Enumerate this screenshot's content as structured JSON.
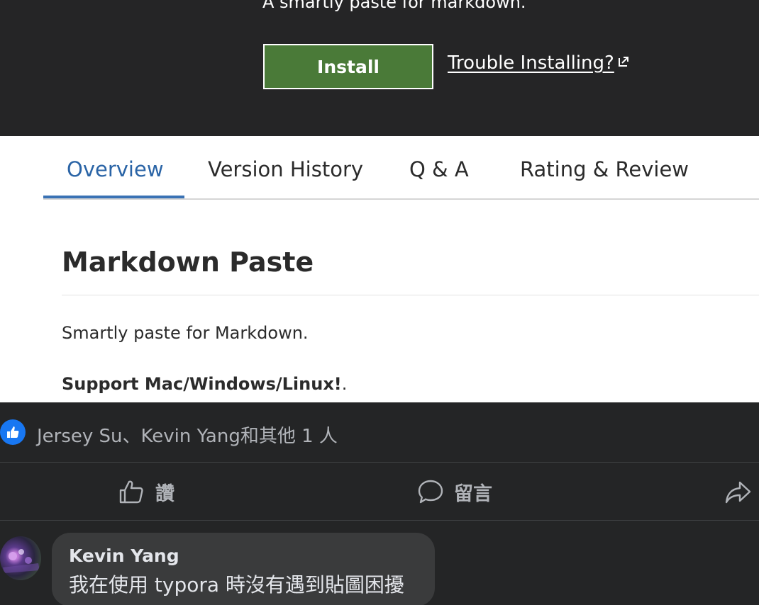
{
  "extension": {
    "tagline": "A smartly paste for markdown.",
    "install_label": "Install",
    "trouble_label": "Trouble Installing?"
  },
  "tabs": [
    {
      "label": "Overview",
      "active": true
    },
    {
      "label": "Version History",
      "active": false
    },
    {
      "label": "Q & A",
      "active": false
    },
    {
      "label": "Rating & Review",
      "active": false
    }
  ],
  "readme": {
    "title": "Markdown Paste",
    "paragraph1": "Smartly paste for Markdown.",
    "paragraph2_bold": "Support Mac/Windows/Linux!",
    "paragraph2_tail": "."
  },
  "facebook": {
    "reactors": "Jersey Su、Kevin Yang和其他 1 人",
    "like_label": "讚",
    "comment_label": "留言",
    "comment": {
      "author": "Kevin Yang",
      "text": "我在使用 typora 時沒有遇到貼圖困擾"
    }
  },
  "colors": {
    "install_green": "#4a7a38",
    "tab_active_blue": "#2a64a6",
    "facebook_blue": "#1877f2"
  },
  "icons": [
    "external-link-icon",
    "like-reaction-icon",
    "thumbs-up-icon",
    "comment-icon",
    "share-icon"
  ]
}
